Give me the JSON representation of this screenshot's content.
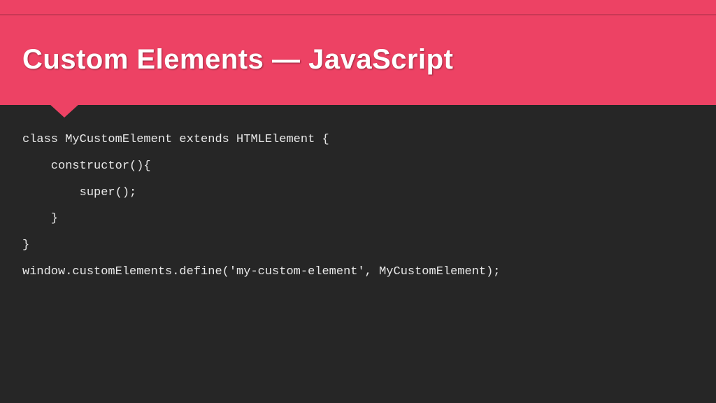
{
  "slide": {
    "title": "Custom Elements — JavaScript",
    "code_lines": [
      "class MyCustomElement extends HTMLElement {",
      "    constructor(){",
      "        super();",
      "",
      "    }",
      "}",
      "window.customElements.define('my-custom-element', MyCustomElement);"
    ]
  },
  "colors": {
    "accent": "#ed4264",
    "background": "#262626",
    "text": "#e8e8e8"
  }
}
